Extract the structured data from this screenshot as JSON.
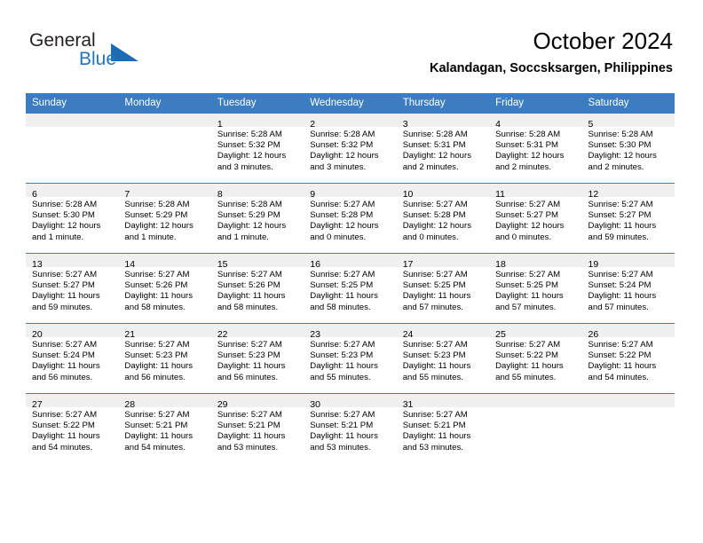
{
  "brand": {
    "name_top": "General",
    "name_bottom": "Blue",
    "color_top": "#231f20",
    "color_bottom": "#2175c0",
    "triangle_color": "#1a6cb5"
  },
  "header": {
    "title": "October 2024",
    "subtitle": "Kalandagan, Soccsksargen, Philippines"
  },
  "theme": {
    "header_blue": "#3b7dc0",
    "daynum_band": "#f0f0f0",
    "grid_line": "#3b7dc0"
  },
  "weekday_headers": [
    "Sunday",
    "Monday",
    "Tuesday",
    "Wednesday",
    "Thursday",
    "Friday",
    "Saturday"
  ],
  "weeks": [
    [
      {
        "day": "",
        "sunrise": "",
        "sunset": "",
        "daylight_1": "",
        "daylight_2": ""
      },
      {
        "day": "",
        "sunrise": "",
        "sunset": "",
        "daylight_1": "",
        "daylight_2": ""
      },
      {
        "day": "1",
        "sunrise": "Sunrise: 5:28 AM",
        "sunset": "Sunset: 5:32 PM",
        "daylight_1": "Daylight: 12 hours",
        "daylight_2": "and 3 minutes."
      },
      {
        "day": "2",
        "sunrise": "Sunrise: 5:28 AM",
        "sunset": "Sunset: 5:32 PM",
        "daylight_1": "Daylight: 12 hours",
        "daylight_2": "and 3 minutes."
      },
      {
        "day": "3",
        "sunrise": "Sunrise: 5:28 AM",
        "sunset": "Sunset: 5:31 PM",
        "daylight_1": "Daylight: 12 hours",
        "daylight_2": "and 2 minutes."
      },
      {
        "day": "4",
        "sunrise": "Sunrise: 5:28 AM",
        "sunset": "Sunset: 5:31 PM",
        "daylight_1": "Daylight: 12 hours",
        "daylight_2": "and 2 minutes."
      },
      {
        "day": "5",
        "sunrise": "Sunrise: 5:28 AM",
        "sunset": "Sunset: 5:30 PM",
        "daylight_1": "Daylight: 12 hours",
        "daylight_2": "and 2 minutes."
      }
    ],
    [
      {
        "day": "6",
        "sunrise": "Sunrise: 5:28 AM",
        "sunset": "Sunset: 5:30 PM",
        "daylight_1": "Daylight: 12 hours",
        "daylight_2": "and 1 minute."
      },
      {
        "day": "7",
        "sunrise": "Sunrise: 5:28 AM",
        "sunset": "Sunset: 5:29 PM",
        "daylight_1": "Daylight: 12 hours",
        "daylight_2": "and 1 minute."
      },
      {
        "day": "8",
        "sunrise": "Sunrise: 5:28 AM",
        "sunset": "Sunset: 5:29 PM",
        "daylight_1": "Daylight: 12 hours",
        "daylight_2": "and 1 minute."
      },
      {
        "day": "9",
        "sunrise": "Sunrise: 5:27 AM",
        "sunset": "Sunset: 5:28 PM",
        "daylight_1": "Daylight: 12 hours",
        "daylight_2": "and 0 minutes."
      },
      {
        "day": "10",
        "sunrise": "Sunrise: 5:27 AM",
        "sunset": "Sunset: 5:28 PM",
        "daylight_1": "Daylight: 12 hours",
        "daylight_2": "and 0 minutes."
      },
      {
        "day": "11",
        "sunrise": "Sunrise: 5:27 AM",
        "sunset": "Sunset: 5:27 PM",
        "daylight_1": "Daylight: 12 hours",
        "daylight_2": "and 0 minutes."
      },
      {
        "day": "12",
        "sunrise": "Sunrise: 5:27 AM",
        "sunset": "Sunset: 5:27 PM",
        "daylight_1": "Daylight: 11 hours",
        "daylight_2": "and 59 minutes."
      }
    ],
    [
      {
        "day": "13",
        "sunrise": "Sunrise: 5:27 AM",
        "sunset": "Sunset: 5:27 PM",
        "daylight_1": "Daylight: 11 hours",
        "daylight_2": "and 59 minutes."
      },
      {
        "day": "14",
        "sunrise": "Sunrise: 5:27 AM",
        "sunset": "Sunset: 5:26 PM",
        "daylight_1": "Daylight: 11 hours",
        "daylight_2": "and 58 minutes."
      },
      {
        "day": "15",
        "sunrise": "Sunrise: 5:27 AM",
        "sunset": "Sunset: 5:26 PM",
        "daylight_1": "Daylight: 11 hours",
        "daylight_2": "and 58 minutes."
      },
      {
        "day": "16",
        "sunrise": "Sunrise: 5:27 AM",
        "sunset": "Sunset: 5:25 PM",
        "daylight_1": "Daylight: 11 hours",
        "daylight_2": "and 58 minutes."
      },
      {
        "day": "17",
        "sunrise": "Sunrise: 5:27 AM",
        "sunset": "Sunset: 5:25 PM",
        "daylight_1": "Daylight: 11 hours",
        "daylight_2": "and 57 minutes."
      },
      {
        "day": "18",
        "sunrise": "Sunrise: 5:27 AM",
        "sunset": "Sunset: 5:25 PM",
        "daylight_1": "Daylight: 11 hours",
        "daylight_2": "and 57 minutes."
      },
      {
        "day": "19",
        "sunrise": "Sunrise: 5:27 AM",
        "sunset": "Sunset: 5:24 PM",
        "daylight_1": "Daylight: 11 hours",
        "daylight_2": "and 57 minutes."
      }
    ],
    [
      {
        "day": "20",
        "sunrise": "Sunrise: 5:27 AM",
        "sunset": "Sunset: 5:24 PM",
        "daylight_1": "Daylight: 11 hours",
        "daylight_2": "and 56 minutes."
      },
      {
        "day": "21",
        "sunrise": "Sunrise: 5:27 AM",
        "sunset": "Sunset: 5:23 PM",
        "daylight_1": "Daylight: 11 hours",
        "daylight_2": "and 56 minutes."
      },
      {
        "day": "22",
        "sunrise": "Sunrise: 5:27 AM",
        "sunset": "Sunset: 5:23 PM",
        "daylight_1": "Daylight: 11 hours",
        "daylight_2": "and 56 minutes."
      },
      {
        "day": "23",
        "sunrise": "Sunrise: 5:27 AM",
        "sunset": "Sunset: 5:23 PM",
        "daylight_1": "Daylight: 11 hours",
        "daylight_2": "and 55 minutes."
      },
      {
        "day": "24",
        "sunrise": "Sunrise: 5:27 AM",
        "sunset": "Sunset: 5:23 PM",
        "daylight_1": "Daylight: 11 hours",
        "daylight_2": "and 55 minutes."
      },
      {
        "day": "25",
        "sunrise": "Sunrise: 5:27 AM",
        "sunset": "Sunset: 5:22 PM",
        "daylight_1": "Daylight: 11 hours",
        "daylight_2": "and 55 minutes."
      },
      {
        "day": "26",
        "sunrise": "Sunrise: 5:27 AM",
        "sunset": "Sunset: 5:22 PM",
        "daylight_1": "Daylight: 11 hours",
        "daylight_2": "and 54 minutes."
      }
    ],
    [
      {
        "day": "27",
        "sunrise": "Sunrise: 5:27 AM",
        "sunset": "Sunset: 5:22 PM",
        "daylight_1": "Daylight: 11 hours",
        "daylight_2": "and 54 minutes."
      },
      {
        "day": "28",
        "sunrise": "Sunrise: 5:27 AM",
        "sunset": "Sunset: 5:21 PM",
        "daylight_1": "Daylight: 11 hours",
        "daylight_2": "and 54 minutes."
      },
      {
        "day": "29",
        "sunrise": "Sunrise: 5:27 AM",
        "sunset": "Sunset: 5:21 PM",
        "daylight_1": "Daylight: 11 hours",
        "daylight_2": "and 53 minutes."
      },
      {
        "day": "30",
        "sunrise": "Sunrise: 5:27 AM",
        "sunset": "Sunset: 5:21 PM",
        "daylight_1": "Daylight: 11 hours",
        "daylight_2": "and 53 minutes."
      },
      {
        "day": "31",
        "sunrise": "Sunrise: 5:27 AM",
        "sunset": "Sunset: 5:21 PM",
        "daylight_1": "Daylight: 11 hours",
        "daylight_2": "and 53 minutes."
      },
      {
        "day": "",
        "sunrise": "",
        "sunset": "",
        "daylight_1": "",
        "daylight_2": ""
      },
      {
        "day": "",
        "sunrise": "",
        "sunset": "",
        "daylight_1": "",
        "daylight_2": ""
      }
    ]
  ]
}
